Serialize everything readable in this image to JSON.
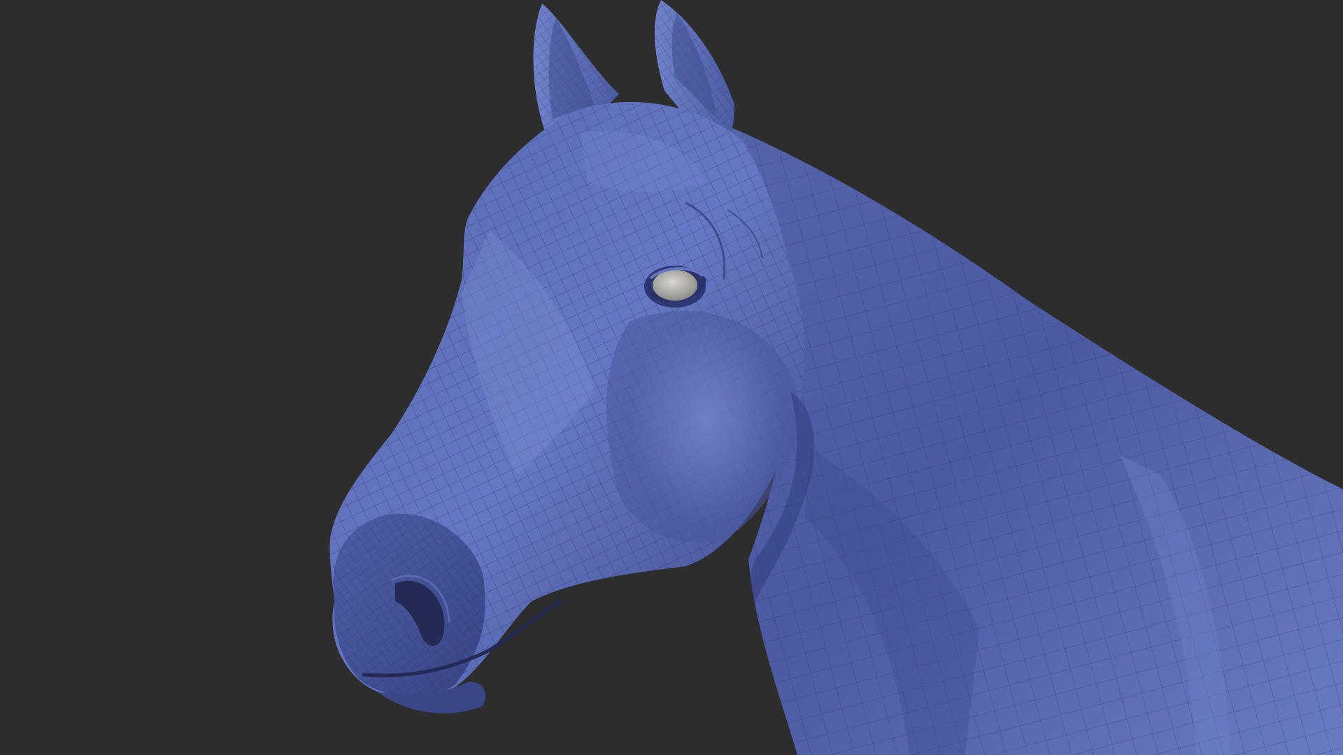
{
  "viewport": {
    "background_color": "#2d2d2d",
    "model_subject": "horse-head-and-neck",
    "model_material": "wireframe-shaded",
    "colors": {
      "mesh_base": "#5a6bb5",
      "mesh_highlight": "#8393d8",
      "mesh_shadow": "#2c3466",
      "wire_color": "#27305a",
      "eye_color": "#b9b7b0"
    }
  }
}
